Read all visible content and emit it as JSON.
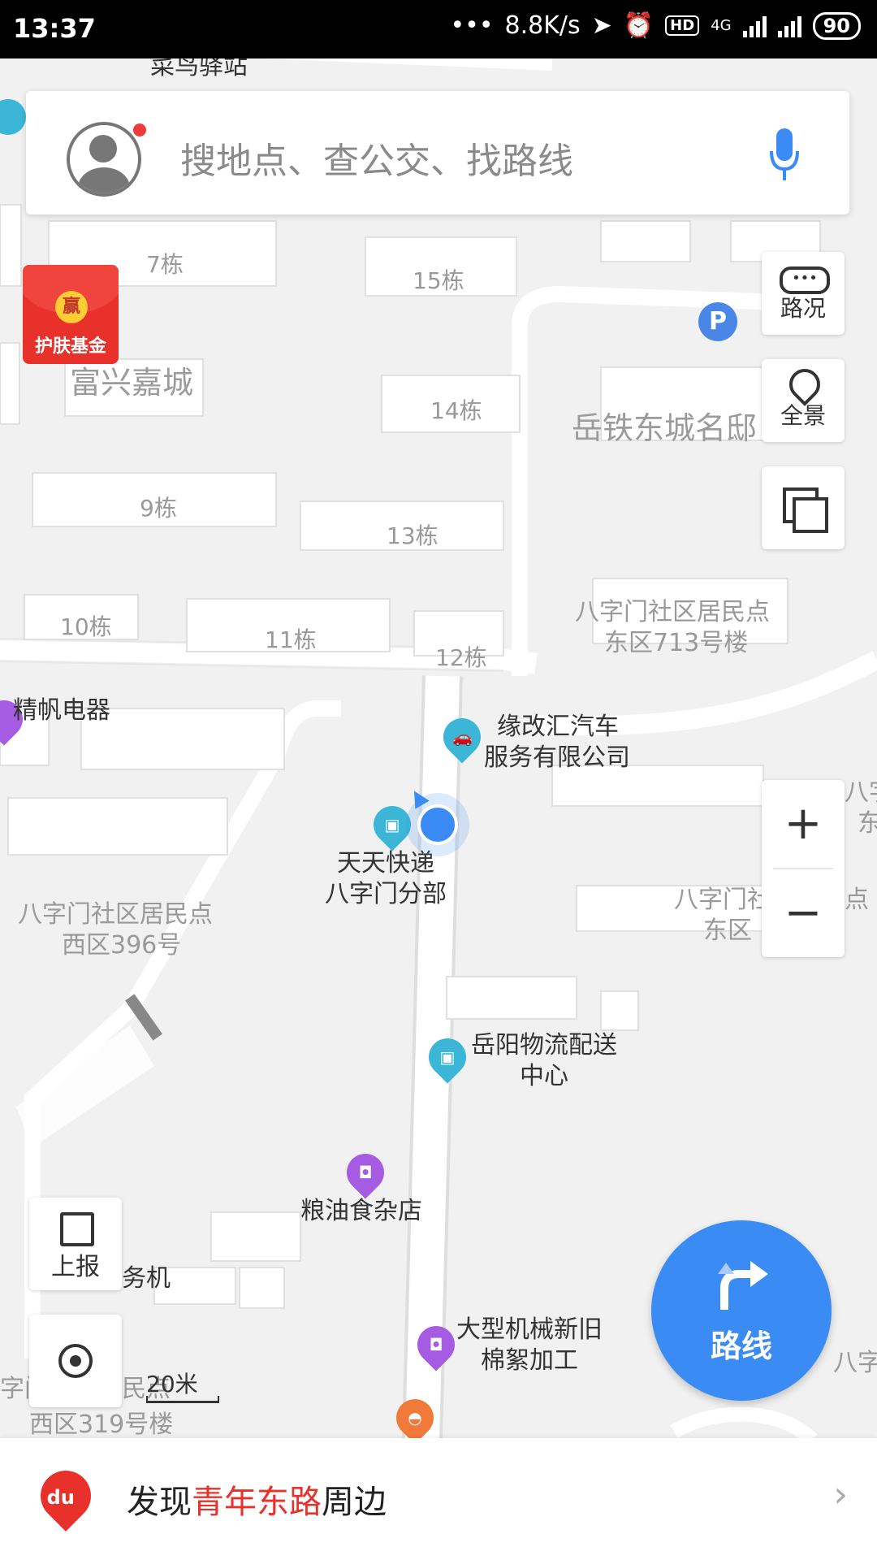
{
  "status_bar": {
    "time": "13:37",
    "speed": "8.8K/s",
    "hd": "HD",
    "network": "4G",
    "battery": "90"
  },
  "search": {
    "placeholder": "搜地点、查公交、找路线"
  },
  "red_packet": {
    "coin": "赢",
    "label": "护肤基金"
  },
  "tools": {
    "traffic": "路况",
    "panorama": "全景"
  },
  "zoom": {
    "in": "+",
    "out": "−"
  },
  "left_tools": {
    "report": "上报"
  },
  "route_button": {
    "label": "路线"
  },
  "scale": {
    "label": "20米"
  },
  "discover": {
    "prefix": "发现",
    "road": "青年东路",
    "suffix": "周边",
    "logo": "du"
  },
  "map_labels": {
    "top_station": "菜鸟驿站",
    "b7": "7栋",
    "b15": "15栋",
    "b14": "14栋",
    "b9": "9栋",
    "b13": "13栋",
    "b10": "10栋",
    "b11": "11栋",
    "b12": "12栋",
    "area_fuxing": "富兴嘉城",
    "area_yuetie": "岳铁东城名邸",
    "area_east_line1": "八字门社区居民点",
    "area_east_line2": "东区713号楼",
    "area_west_line1": "八字门社区居民点",
    "area_west_line2": "西区396号",
    "area_west2_line1": "八字门社区居民点",
    "area_west2_line2": "西区319号楼",
    "area_mid_line1": "八字门社区居民点",
    "area_mid_line2": "东区",
    "partial_right_1": "八字",
    "partial_right_2": "东",
    "partial_right_3": "八字",
    "partial_machine": "务机"
  },
  "pois": {
    "jingfan": "精帆电器",
    "car_line1": "缘改汇汽车",
    "car_line2": "服务有限公司",
    "express_line1": "天天快递",
    "express_line2": "八字门分部",
    "logistics_line1": "岳阳物流配送",
    "logistics_line2": "中心",
    "grocery": "粮油食杂店",
    "machine_line1": "大型机械新旧",
    "machine_line2": "棉絮加工",
    "parking": "P"
  },
  "colors": {
    "accent_blue": "#3b8bf5",
    "poi_teal": "#3bb6d6",
    "poi_purple": "#a65be3",
    "highlight_red": "#e8312a"
  }
}
